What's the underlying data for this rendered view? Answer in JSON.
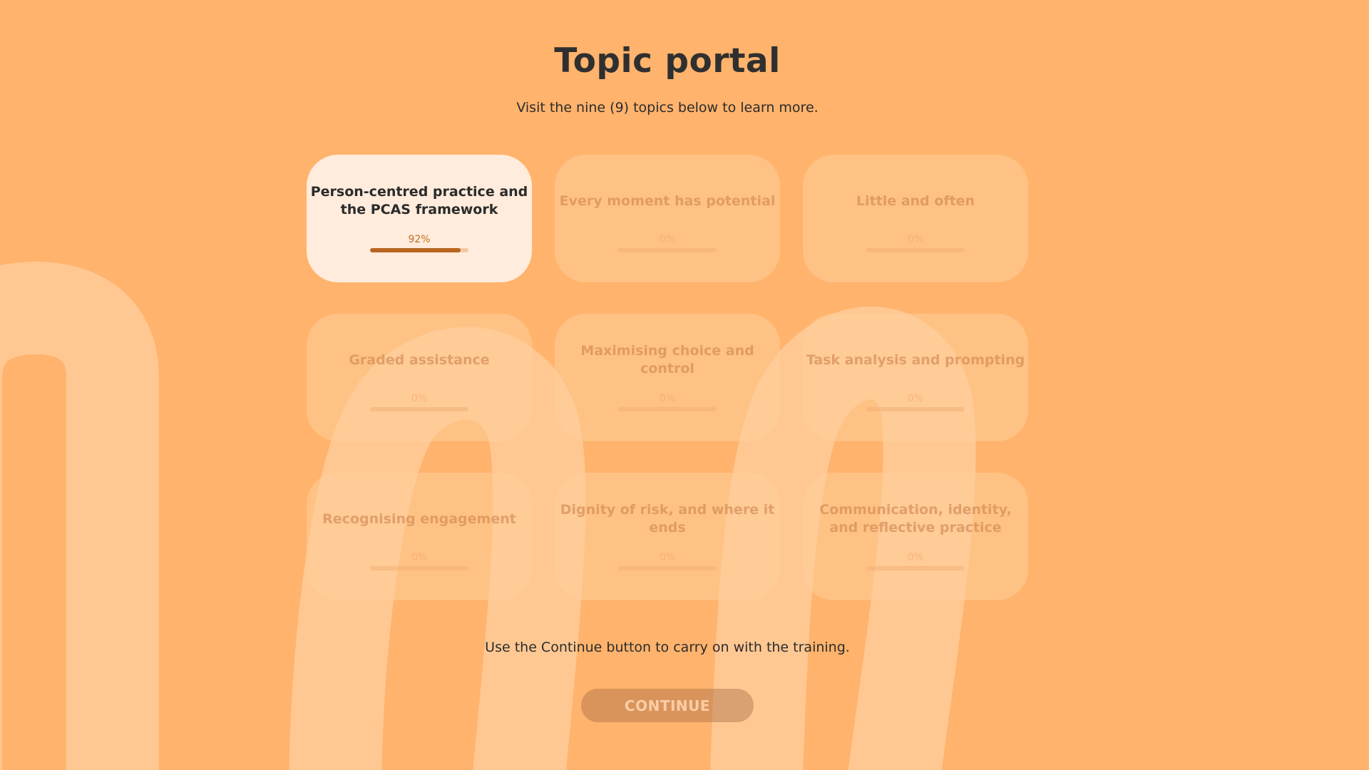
{
  "header": {
    "title": "Topic portal",
    "subtitle": "Visit the nine (9) topics below to learn more."
  },
  "topics": [
    {
      "title": "Person-centred practice and the PCAS framework",
      "progress_label": "92%",
      "progress": 0.92,
      "active": true
    },
    {
      "title": "Every moment has potential",
      "progress_label": "0%",
      "progress": 0,
      "active": false
    },
    {
      "title": "Little and often",
      "progress_label": "0%",
      "progress": 0,
      "active": false
    },
    {
      "title": "Graded assistance",
      "progress_label": "0%",
      "progress": 0,
      "active": false
    },
    {
      "title": "Maximising choice and control",
      "progress_label": "0%",
      "progress": 0,
      "active": false
    },
    {
      "title": "Task analysis and prompting",
      "progress_label": "0%",
      "progress": 0,
      "active": false
    },
    {
      "title": "Recognising engagement",
      "progress_label": "0%",
      "progress": 0,
      "active": false
    },
    {
      "title": "Dignity of risk, and where it ends",
      "progress_label": "0%",
      "progress": 0,
      "active": false
    },
    {
      "title": "Communication, identity, and reflective practice",
      "progress_label": "0%",
      "progress": 0,
      "active": false
    }
  ],
  "footer": {
    "instruction": "Use the Continue button to carry on with the training.",
    "continue_label": "CONTINUE"
  },
  "colors": {
    "background": "#ffb36c",
    "active_card": "#ffecdc",
    "progress_fill": "#b8651f",
    "text": "#2b2b2b"
  }
}
